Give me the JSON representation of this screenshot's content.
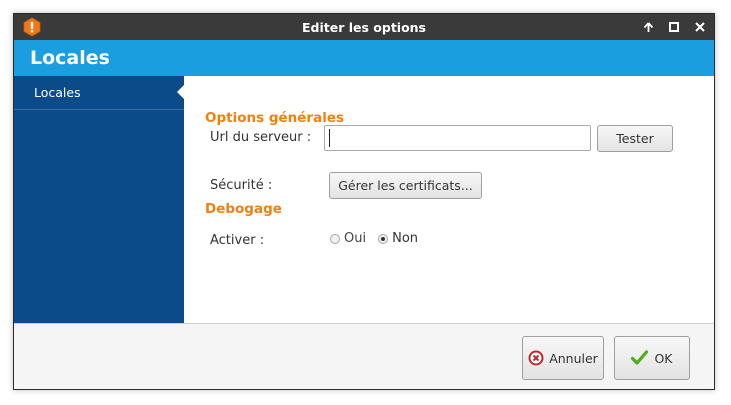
{
  "window": {
    "title": "Editer les options"
  },
  "banner": {
    "title": "Locales"
  },
  "sidebar": {
    "items": [
      {
        "label": "Locales"
      }
    ]
  },
  "general": {
    "title": "Options générales",
    "url_label": "Url du serveur :",
    "url_value": "",
    "test_button": "Tester",
    "security_label": "Sécurité :",
    "certs_button": "Gérer les certificats..."
  },
  "debug": {
    "title": "Debogage",
    "activate_label": "Activer :",
    "option_yes": "Oui",
    "option_no": "Non",
    "selected": "Non"
  },
  "footer": {
    "cancel_label": "Annuler",
    "ok_label": "OK"
  },
  "colors": {
    "titlebar": "#3a3a3a",
    "banner": "#1a9ee0",
    "sidebar": "#0b4b8a",
    "section_title": "#f08010",
    "cancel_icon": "#c0282d",
    "ok_icon": "#4caf1a"
  },
  "icons": {
    "app": "app-logo-icon",
    "maximize": "arrow-up-icon",
    "restore": "square-icon",
    "close": "close-icon",
    "cancel": "cancel-circle-icon",
    "ok": "checkmark-icon"
  }
}
